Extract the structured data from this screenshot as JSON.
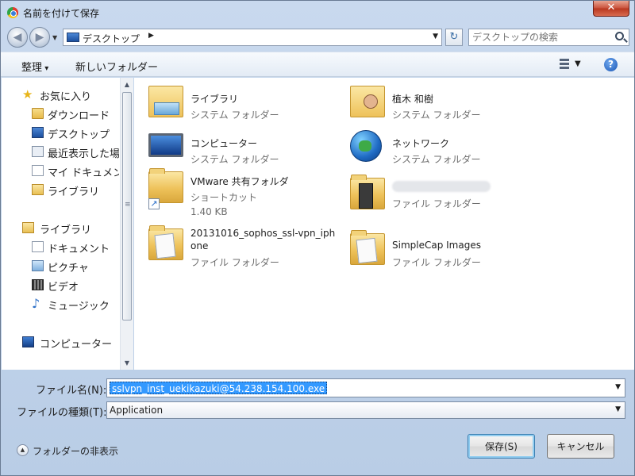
{
  "window": {
    "title": "名前を付けて保存",
    "close_label": "✕"
  },
  "nav": {
    "address": "デスクトップ",
    "search_placeholder": "デスクトップの検索"
  },
  "toolbar": {
    "organize": "整理",
    "new_folder": "新しいフォルダー",
    "help": "?"
  },
  "sidebar": {
    "favorites": {
      "label": "お気に入り",
      "items": [
        "ダウンロード",
        "デスクトップ",
        "最近表示した場所",
        "マイ ドキュメント",
        "ライブラリ"
      ]
    },
    "libraries": {
      "label": "ライブラリ",
      "items": [
        "ドキュメント",
        "ピクチャ",
        "ビデオ",
        "ミュージック"
      ]
    },
    "computer": "コンピューター"
  },
  "files": [
    {
      "name": "ライブラリ",
      "type": "システム フォルダー",
      "icon": "library-icon"
    },
    {
      "name": "植木 和樹",
      "type": "システム フォルダー",
      "icon": "user-folder-icon"
    },
    {
      "name": "コンピューター",
      "type": "システム フォルダー",
      "icon": "computer-icon"
    },
    {
      "name": "ネットワーク",
      "type": "システム フォルダー",
      "icon": "network-icon"
    },
    {
      "name": "VMware 共有フォルダ",
      "type": "ショートカット",
      "size": "1.40 KB",
      "icon": "shortcut-folder-icon"
    },
    {
      "name": "",
      "type": "ファイル フォルダー",
      "icon": "folder-icon"
    },
    {
      "name": "20131016_sophos_ssl-vpn_iphone",
      "type": "ファイル フォルダー",
      "icon": "folder-icon"
    },
    {
      "name": "SimpleCap Images",
      "type": "ファイル フォルダー",
      "icon": "folder-icon"
    }
  ],
  "form": {
    "filename_label": "ファイル名(N):",
    "filename_value": "sslvpn_inst_uekikazuki@54.238.154.100.exe",
    "filetype_label": "ファイルの種類(T):",
    "filetype_value": "Application"
  },
  "footer": {
    "hide_folders": "フォルダーの非表示",
    "save": "保存(S)",
    "cancel": "キャンセル"
  }
}
